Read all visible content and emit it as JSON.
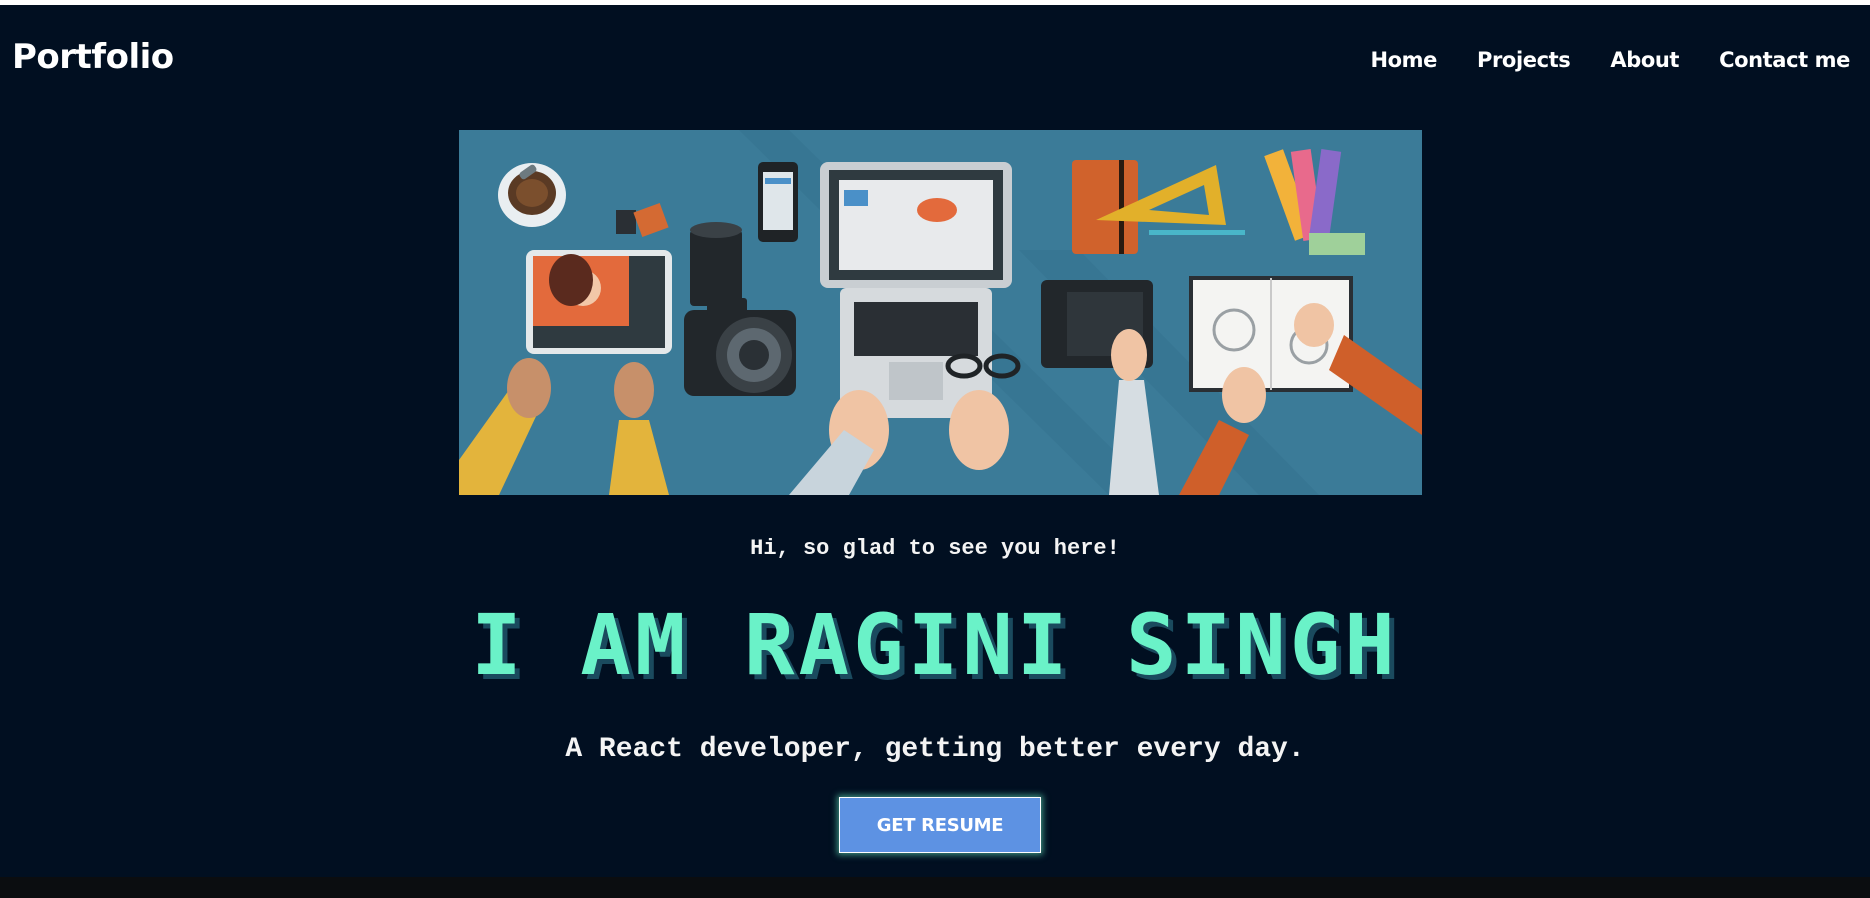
{
  "navbar": {
    "brand": "Portfolio",
    "links": [
      {
        "label": "Home"
      },
      {
        "label": "Projects"
      },
      {
        "label": "About"
      },
      {
        "label": "Contact me"
      }
    ]
  },
  "hero": {
    "greeting": "Hi, so glad to see you here!",
    "headline": "I AM RAGINI SINGH",
    "subtitle": "A React developer, getting better every day.",
    "resume_button": "GET RESUME"
  },
  "colors": {
    "background": "#010f21",
    "accent": "#6af2c8",
    "button": "#5d92e3"
  }
}
